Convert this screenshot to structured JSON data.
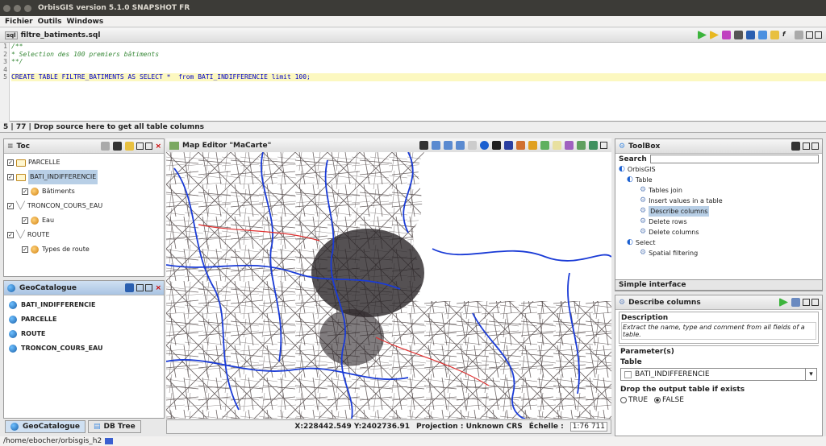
{
  "window": {
    "title": "OrbisGIS version 5.1.0 SNAPSHOT FR"
  },
  "menu": [
    "Fichier",
    "Outils",
    "Windows"
  ],
  "editor": {
    "tab_title": "filtre_batiments.sql",
    "lines": [
      {
        "n": "1",
        "text": "/**"
      },
      {
        "n": "2",
        "text": "* Selection des 100 premiers bâtiments"
      },
      {
        "n": "3",
        "text": "**/"
      },
      {
        "n": "4",
        "text": ""
      },
      {
        "n": "5",
        "text": "CREATE TABLE FILTRE_BATIMENTS AS SELECT *  from BATI_INDIFFERENCIE limit 100;"
      }
    ],
    "status": "5 | 77 | Drop source here to get all table columns"
  },
  "toc": {
    "title": "Toc",
    "items": [
      {
        "label": "PARCELLE",
        "kind": "layer"
      },
      {
        "label": "BATI_INDIFFERENCIE",
        "kind": "layer"
      },
      {
        "label": "Bâtiments",
        "kind": "style"
      },
      {
        "label": "TRONCON_COURS_EAU",
        "kind": "line"
      },
      {
        "label": "Eau",
        "kind": "style"
      },
      {
        "label": "ROUTE",
        "kind": "line"
      },
      {
        "label": "Types de route",
        "kind": "style"
      }
    ]
  },
  "geocatalogue": {
    "title": "GeoCatalogue",
    "items": [
      "BATI_INDIFFERENCIE",
      "PARCELLE",
      "ROUTE",
      "TRONCON_COURS_EAU"
    ],
    "tabs": [
      "GeoCatalogue",
      "DB Tree"
    ]
  },
  "map": {
    "title": "Map Editor \"MaCarte\"",
    "coords": "X:228442.549 Y:2402736.91",
    "projection": "Projection : Unknown CRS",
    "scale_label": "Échelle :",
    "scale_value": "1:76 711"
  },
  "toolbox": {
    "title": "ToolBox",
    "search_label": "Search",
    "tree": [
      {
        "label": "OrbisGIS",
        "level": 0
      },
      {
        "label": "Table",
        "level": 1
      },
      {
        "label": "Tables join",
        "level": 2
      },
      {
        "label": "Insert values in a table",
        "level": 2
      },
      {
        "label": "Describe columns",
        "level": 2
      },
      {
        "label": "Delete rows",
        "level": 2
      },
      {
        "label": "Delete columns",
        "level": 2
      },
      {
        "label": "Select",
        "level": 1
      },
      {
        "label": "Spatial filtering",
        "level": 2
      }
    ],
    "simple_interface": "Simple interface"
  },
  "process": {
    "title": "Describe columns",
    "description_legend": "Description",
    "description": "Extract the name, type and comment from all fields of a table.",
    "params_legend": "Parameter(s)",
    "table_label": "Table",
    "table_value": "BATI_INDIFFERENCIE",
    "drop_label": "Drop the output table if exists",
    "opt_true": "TRUE",
    "opt_false": "FALSE"
  },
  "footer_path": "/home/ebocher/orbisgis_h2",
  "colors": {
    "selection": "#b8cfe6",
    "water": "#1a3bd6",
    "road": "#e03030"
  }
}
